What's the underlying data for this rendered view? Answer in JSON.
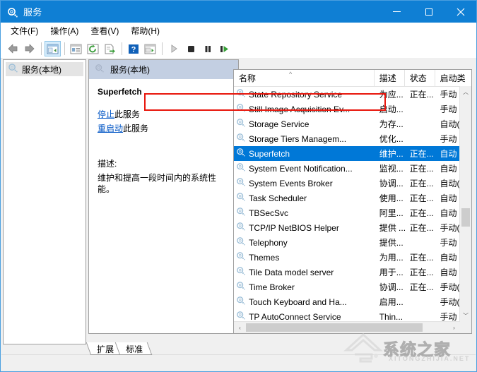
{
  "window": {
    "title": "服务",
    "icon": "services-gear-icon",
    "controls": {
      "minimize": "–",
      "maximize": "□",
      "close": "✕"
    },
    "accent_color": "#0f7fd4",
    "selection_color": "#0078d7",
    "annotation_color": "#e8160c"
  },
  "menu": {
    "items": [
      {
        "label": "文件(F)",
        "name": "menu-file"
      },
      {
        "label": "操作(A)",
        "name": "menu-action"
      },
      {
        "label": "查看(V)",
        "name": "menu-view"
      },
      {
        "label": "帮助(H)",
        "name": "menu-help"
      }
    ]
  },
  "toolbar": {
    "buttons": [
      {
        "name": "back-button",
        "icon": "arrow-left-icon"
      },
      {
        "name": "forward-button",
        "icon": "arrow-right-icon"
      },
      {
        "name": "show-hide-tree-button",
        "icon": "tree-panel-icon"
      },
      {
        "name": "properties-button",
        "icon": "properties-icon"
      },
      {
        "name": "refresh-button",
        "icon": "refresh-icon"
      },
      {
        "name": "export-list-button",
        "icon": "export-icon"
      },
      {
        "name": "help-button",
        "icon": "help-icon"
      },
      {
        "name": "show-action-pane-button",
        "icon": "action-pane-icon"
      },
      {
        "name": "start-service-button",
        "icon": "play-icon"
      },
      {
        "name": "stop-service-button",
        "icon": "stop-icon"
      },
      {
        "name": "pause-service-button",
        "icon": "pause-icon"
      },
      {
        "name": "restart-service-button",
        "icon": "restart-icon"
      }
    ]
  },
  "tree": {
    "root": {
      "label": "服务(本地)",
      "icon": "services-gear-icon"
    }
  },
  "details": {
    "header": {
      "label": "服务(本地)",
      "icon": "services-gear-icon"
    },
    "service_name": "Superfetch",
    "links": [
      {
        "link_text": "停止",
        "suffix": "此服务",
        "name": "stop-service-link"
      },
      {
        "link_text": "重启动",
        "suffix": "此服务",
        "name": "restart-service-link"
      }
    ],
    "description_label": "描述:",
    "description_text": "维护和提高一段时间内的系统性能。"
  },
  "list": {
    "columns": [
      {
        "label": "名称",
        "name": "column-name",
        "sorted": "asc",
        "caret": "^"
      },
      {
        "label": "描述",
        "name": "column-description"
      },
      {
        "label": "状态",
        "name": "column-status"
      },
      {
        "label": "启动类",
        "name": "column-startup-type"
      }
    ],
    "rows": [
      {
        "name": "State Repository Service",
        "description": "为应...",
        "status": "正在...",
        "startup": "手动",
        "selected": false
      },
      {
        "name": "Still Image Acquisition Ev...",
        "description": "启动...",
        "status": "",
        "startup": "手动",
        "selected": false
      },
      {
        "name": "Storage Service",
        "description": "为存...",
        "status": "",
        "startup": "自动(延",
        "selected": false
      },
      {
        "name": "Storage Tiers Managem...",
        "description": "优化...",
        "status": "",
        "startup": "手动",
        "selected": false
      },
      {
        "name": "Superfetch",
        "description": "维护...",
        "status": "正在...",
        "startup": "自动",
        "selected": true
      },
      {
        "name": "System Event Notification...",
        "description": "监视...",
        "status": "正在...",
        "startup": "自动",
        "selected": false
      },
      {
        "name": "System Events Broker",
        "description": "协调...",
        "status": "正在...",
        "startup": "自动(触",
        "selected": false
      },
      {
        "name": "Task Scheduler",
        "description": "使用...",
        "status": "正在...",
        "startup": "自动",
        "selected": false
      },
      {
        "name": "TBSecSvc",
        "description": "阿里...",
        "status": "正在...",
        "startup": "自动",
        "selected": false
      },
      {
        "name": "TCP/IP NetBIOS Helper",
        "description": "提供 ...",
        "status": "正在...",
        "startup": "手动(触",
        "selected": false
      },
      {
        "name": "Telephony",
        "description": "提供...",
        "status": "",
        "startup": "手动",
        "selected": false
      },
      {
        "name": "Themes",
        "description": "为用...",
        "status": "正在...",
        "startup": "自动",
        "selected": false
      },
      {
        "name": "Tile Data model server",
        "description": "用于...",
        "status": "正在...",
        "startup": "自动",
        "selected": false
      },
      {
        "name": "Time Broker",
        "description": "协调...",
        "status": "正在...",
        "startup": "手动(触",
        "selected": false
      },
      {
        "name": "Touch Keyboard and Ha...",
        "description": "启用...",
        "status": "",
        "startup": "手动(触",
        "selected": false
      },
      {
        "name": "TP AutoConnect Service",
        "description": "Thin...",
        "status": "",
        "startup": "手动",
        "selected": false
      }
    ],
    "scroll": {
      "up_arrow": "︿",
      "down_arrow": "﹀",
      "left_arrow": "‹",
      "right_arrow": "›"
    }
  },
  "tabs": [
    {
      "label": "扩展",
      "name": "tab-extended"
    },
    {
      "label": "标准",
      "name": "tab-standard"
    }
  ],
  "watermark": {
    "text": "系统之家",
    "subtext": "XITONGZHIJIA.NET"
  }
}
